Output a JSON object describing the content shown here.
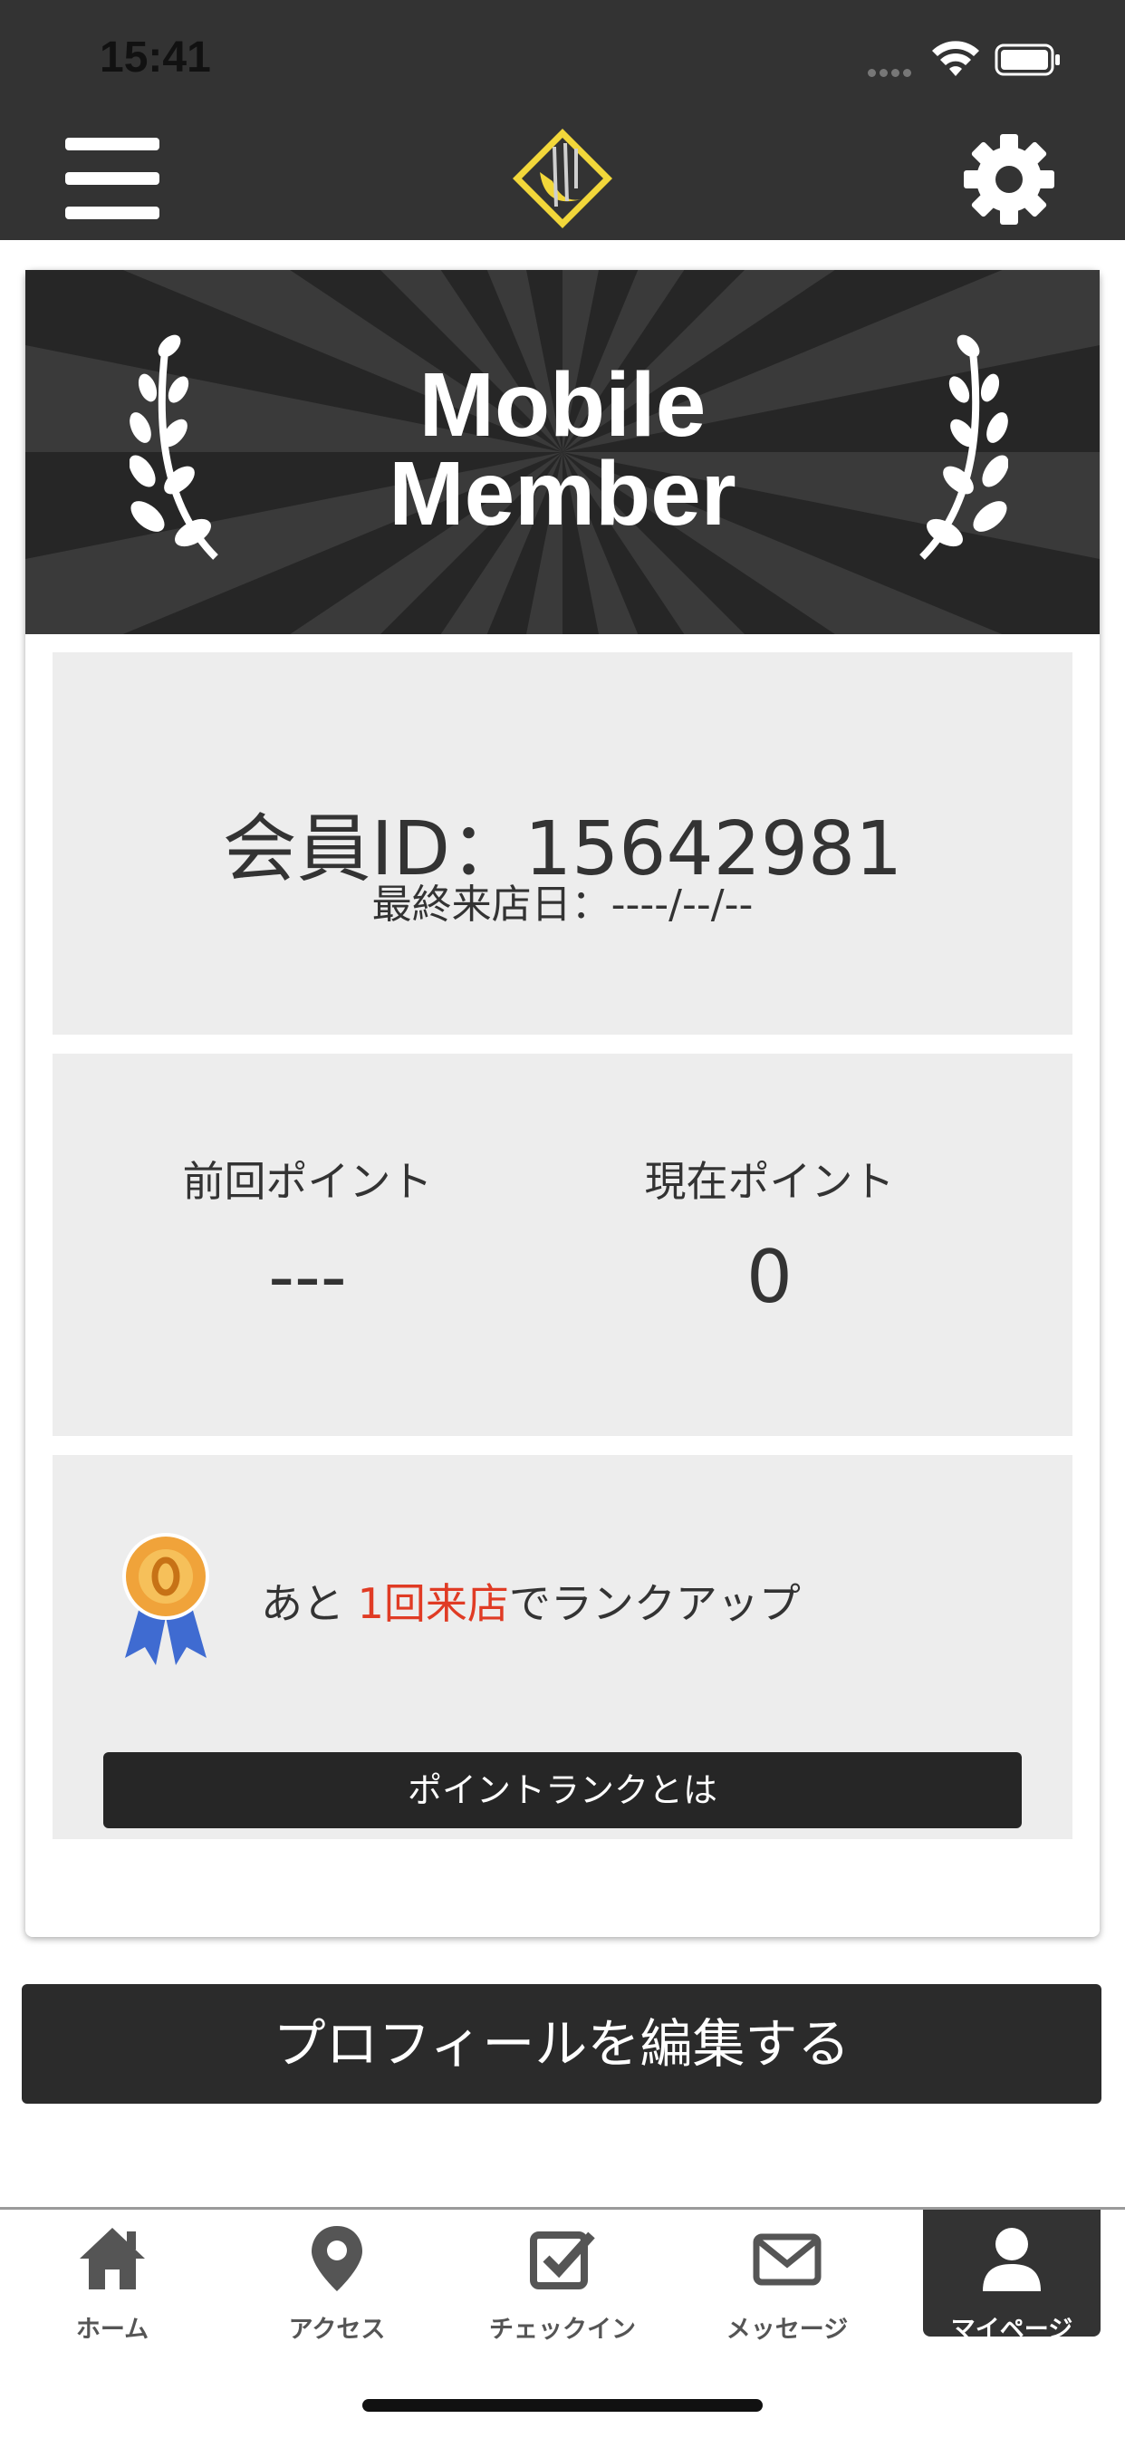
{
  "status_bar": {
    "time": "15:41"
  },
  "banner": {
    "line1": "Mobile",
    "line2": "Member"
  },
  "member": {
    "id_label": "会員ID：",
    "id_value": "15642981",
    "last_visit_label": "最終来店日：",
    "last_visit_value": "----/--/--"
  },
  "points": {
    "previous_label": "前回ポイント",
    "previous_value": "---",
    "current_label": "現在ポイント",
    "current_value": "0"
  },
  "rank": {
    "prefix": "あと ",
    "highlight": "1回来店",
    "suffix": "でランクアップ",
    "button_label": "ポイントランクとは"
  },
  "profile_button_label": "プロフィールを編集する",
  "tabs": [
    {
      "label": "ホーム",
      "icon": "home-icon"
    },
    {
      "label": "アクセス",
      "icon": "map-pin-icon"
    },
    {
      "label": "チェックイン",
      "icon": "checkbox-icon"
    },
    {
      "label": "メッセージ",
      "icon": "envelope-icon"
    },
    {
      "label": "マイページ",
      "icon": "user-icon",
      "active": true
    }
  ],
  "colors": {
    "header_bg": "#333333",
    "panel_bg": "#ededed",
    "accent_red": "#e03b24",
    "button_bg": "#262626"
  }
}
